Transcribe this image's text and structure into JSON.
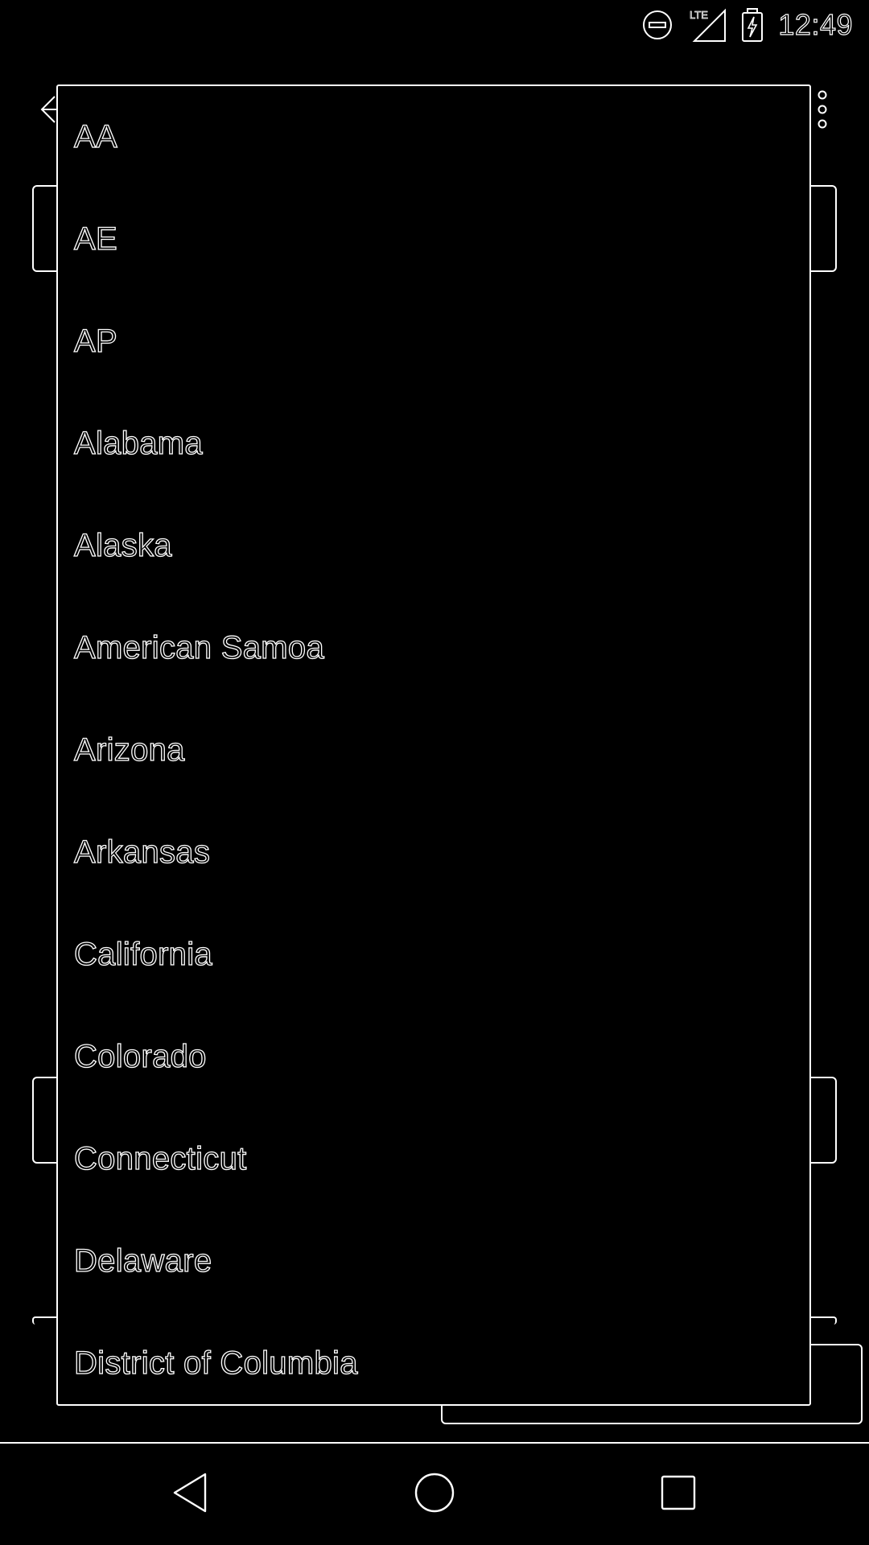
{
  "status_bar": {
    "time": "12:49",
    "icons": [
      "do-not-disturb-icon",
      "lte-signal-icon",
      "battery-charging-icon"
    ],
    "network_label": "LTE"
  },
  "background_app": {
    "icons": [
      "back-arrow-icon",
      "more-vert-icon"
    ]
  },
  "dropdown": {
    "options": [
      "AA",
      "AE",
      "AP",
      "Alabama",
      "Alaska",
      "American Samoa",
      "Arizona",
      "Arkansas",
      "California",
      "Colorado",
      "Connecticut",
      "Delaware",
      "District of Columbia"
    ]
  },
  "nav_bar": {
    "icons": [
      "nav-back-icon",
      "nav-home-icon",
      "nav-recents-icon"
    ]
  },
  "colors": {
    "background": "#000000",
    "outline": "#ffffff"
  }
}
